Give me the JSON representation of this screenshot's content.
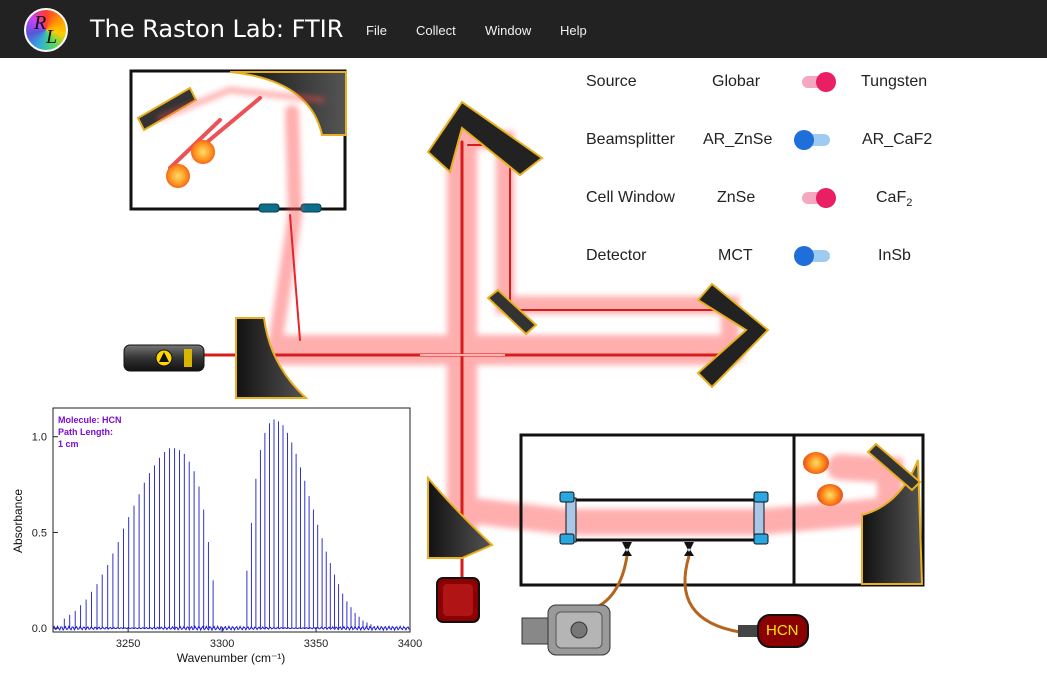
{
  "app": {
    "title": "The Raston Lab: FTIR",
    "logo_letters": [
      "R",
      "L"
    ]
  },
  "menu": {
    "items": [
      "File",
      "Collect",
      "Window",
      "Help"
    ]
  },
  "settings": [
    {
      "label": "Source",
      "left": "Globar",
      "right": "Tungsten",
      "selected": "right",
      "color": "#e91e63"
    },
    {
      "label": "Beamsplitter",
      "left": "AR_ZnSe",
      "right": "AR_CaF2",
      "selected": "left",
      "color": "#1e6fd9"
    },
    {
      "label": "Cell Window",
      "left": "ZnSe",
      "right": "CaF2",
      "selected": "right",
      "color": "#e91e63"
    },
    {
      "label": "Detector",
      "left": "MCT",
      "right": "InSb",
      "selected": "left",
      "color": "#1e6fd9"
    }
  ],
  "apparatus": {
    "gas_bottle_label": "HCN",
    "beam_color": "#e8242a",
    "mirror_color": "#2a2a2a",
    "mirror_edge_color": "#e8b020"
  },
  "spectrum": {
    "annotations": [
      "Molecule: HCN",
      "Path Length:",
      "1 cm"
    ]
  },
  "chart_data": {
    "type": "line",
    "xlabel": "Wavenumber (cm⁻¹)",
    "ylabel": "Absorbance",
    "xlim": [
      3210,
      3400
    ],
    "ylim": [
      -0.02,
      1.15
    ],
    "x_ticks": [
      3250,
      3300,
      3350,
      3400
    ],
    "y_ticks": [
      0.0,
      0.5,
      1.0
    ],
    "y_tick_labels": [
      "0.0",
      "0.5",
      "1.0"
    ],
    "series": [
      {
        "color": "#1a1acf",
        "p_branch_peaks": [
          [
            3216.0,
            0.05
          ],
          [
            3218.9,
            0.07
          ],
          [
            3221.8,
            0.09
          ],
          [
            3224.7,
            0.12
          ],
          [
            3227.6,
            0.15
          ],
          [
            3230.5,
            0.19
          ],
          [
            3233.4,
            0.23
          ],
          [
            3236.2,
            0.28
          ],
          [
            3239.1,
            0.33
          ],
          [
            3241.9,
            0.39
          ],
          [
            3244.7,
            0.45
          ],
          [
            3247.5,
            0.52
          ],
          [
            3250.3,
            0.58
          ],
          [
            3253.1,
            0.64
          ],
          [
            3255.8,
            0.7
          ],
          [
            3258.6,
            0.76
          ],
          [
            3261.3,
            0.81
          ],
          [
            3264.0,
            0.85
          ],
          [
            3266.7,
            0.89
          ],
          [
            3269.4,
            0.92
          ],
          [
            3272.0,
            0.94
          ],
          [
            3274.7,
            0.94
          ],
          [
            3277.3,
            0.93
          ],
          [
            3279.9,
            0.91
          ],
          [
            3282.5,
            0.87
          ],
          [
            3285.1,
            0.82
          ],
          [
            3287.7,
            0.74
          ],
          [
            3290.2,
            0.62
          ],
          [
            3292.7,
            0.45
          ],
          [
            3295.2,
            0.25
          ]
        ],
        "r_branch_peaks": [
          [
            3313.2,
            0.3
          ],
          [
            3315.6,
            0.55
          ],
          [
            3318.0,
            0.78
          ],
          [
            3320.4,
            0.93
          ],
          [
            3322.8,
            1.02
          ],
          [
            3325.2,
            1.07
          ],
          [
            3327.6,
            1.09
          ],
          [
            3330.0,
            1.08
          ],
          [
            3332.4,
            1.06
          ],
          [
            3334.8,
            1.02
          ],
          [
            3337.1,
            0.97
          ],
          [
            3339.4,
            0.91
          ],
          [
            3341.7,
            0.84
          ],
          [
            3344.0,
            0.77
          ],
          [
            3346.3,
            0.69
          ],
          [
            3348.6,
            0.62
          ],
          [
            3350.9,
            0.54
          ],
          [
            3353.2,
            0.47
          ],
          [
            3355.4,
            0.4
          ],
          [
            3357.6,
            0.34
          ],
          [
            3359.8,
            0.28
          ],
          [
            3362.0,
            0.23
          ],
          [
            3364.2,
            0.18
          ],
          [
            3366.4,
            0.14
          ],
          [
            3368.6,
            0.11
          ],
          [
            3370.8,
            0.08
          ],
          [
            3372.9,
            0.06
          ],
          [
            3375.0,
            0.04
          ],
          [
            3377.1,
            0.03
          ],
          [
            3379.2,
            0.02
          ]
        ]
      }
    ]
  }
}
